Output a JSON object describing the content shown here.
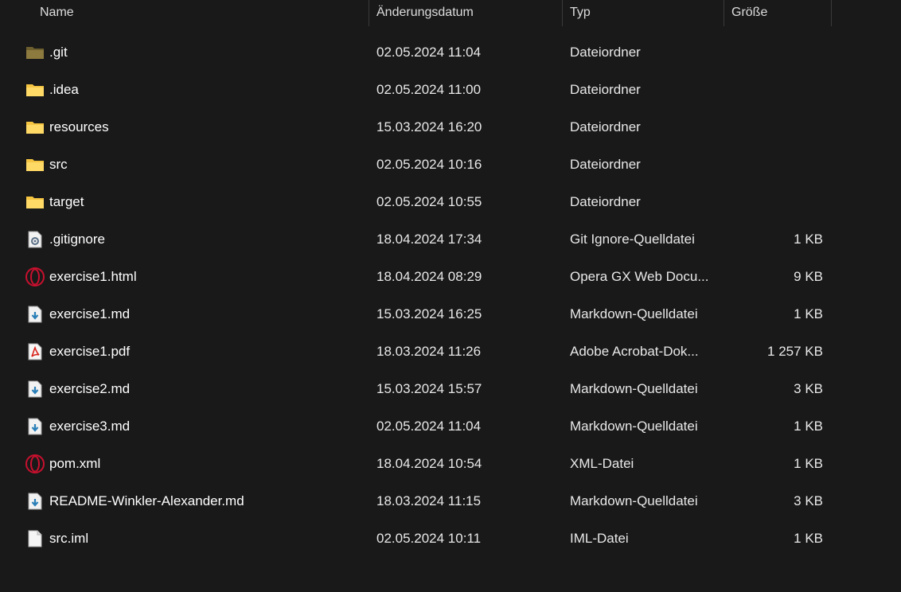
{
  "columns": {
    "name": "Name",
    "date": "Änderungsdatum",
    "type": "Typ",
    "size": "Größe"
  },
  "colors": {
    "background": "#191919",
    "folder": "#f5c542",
    "folder_git": "#8c7a3e",
    "opera": "#c8102e",
    "pdf": "#d9251d",
    "markdown": "#2a7fb8"
  },
  "files": [
    {
      "icon": "folder-git-icon",
      "name": ".git",
      "date": "02.05.2024 11:04",
      "type": "Dateiordner",
      "size": ""
    },
    {
      "icon": "folder-icon",
      "name": ".idea",
      "date": "02.05.2024 11:00",
      "type": "Dateiordner",
      "size": ""
    },
    {
      "icon": "folder-icon",
      "name": "resources",
      "date": "15.03.2024 16:20",
      "type": "Dateiordner",
      "size": ""
    },
    {
      "icon": "folder-icon",
      "name": "src",
      "date": "02.05.2024 10:16",
      "type": "Dateiordner",
      "size": ""
    },
    {
      "icon": "folder-icon",
      "name": "target",
      "date": "02.05.2024 10:55",
      "type": "Dateiordner",
      "size": ""
    },
    {
      "icon": "settings-file-icon",
      "name": ".gitignore",
      "date": "18.04.2024 17:34",
      "type": "Git Ignore-Quelldatei",
      "size": "1 KB"
    },
    {
      "icon": "opera-icon",
      "name": "exercise1.html",
      "date": "18.04.2024 08:29",
      "type": "Opera GX Web Docu...",
      "size": "9 KB"
    },
    {
      "icon": "markdown-file-icon",
      "name": "exercise1.md",
      "date": "15.03.2024 16:25",
      "type": "Markdown-Quelldatei",
      "size": "1 KB"
    },
    {
      "icon": "pdf-file-icon",
      "name": "exercise1.pdf",
      "date": "18.03.2024 11:26",
      "type": "Adobe Acrobat-Dok...",
      "size": "1 257 KB"
    },
    {
      "icon": "markdown-file-icon",
      "name": "exercise2.md",
      "date": "15.03.2024 15:57",
      "type": "Markdown-Quelldatei",
      "size": "3 KB"
    },
    {
      "icon": "markdown-file-icon",
      "name": "exercise3.md",
      "date": "02.05.2024 11:04",
      "type": "Markdown-Quelldatei",
      "size": "1 KB"
    },
    {
      "icon": "opera-icon",
      "name": "pom.xml",
      "date": "18.04.2024 10:54",
      "type": "XML-Datei",
      "size": "1 KB"
    },
    {
      "icon": "markdown-file-icon",
      "name": "README-Winkler-Alexander.md",
      "date": "18.03.2024 11:15",
      "type": "Markdown-Quelldatei",
      "size": "3 KB"
    },
    {
      "icon": "blank-file-icon",
      "name": "src.iml",
      "date": "02.05.2024 10:11",
      "type": "IML-Datei",
      "size": "1 KB"
    }
  ]
}
